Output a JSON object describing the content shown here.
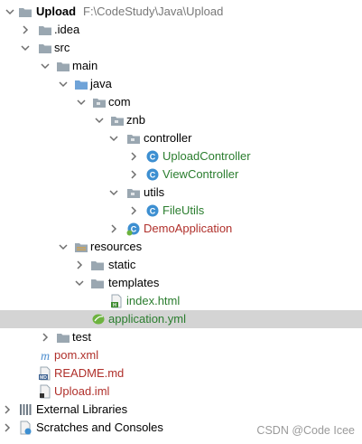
{
  "tree": {
    "project_name": "Upload",
    "project_path": "F:\\CodeStudy\\Java\\Upload",
    "idea": ".idea",
    "src": "src",
    "main": "main",
    "java": "java",
    "com": "com",
    "znb": "znb",
    "controller": "controller",
    "upload_controller": "UploadController",
    "view_controller": "ViewController",
    "utils": "utils",
    "file_utils": "FileUtils",
    "demo_application": "DemoApplication",
    "resources": "resources",
    "static": "static",
    "templates": "templates",
    "index_html": "index.html",
    "application_yml": "application.yml",
    "test": "test",
    "pom_xml": "pom.xml",
    "readme_md": "README.md",
    "upload_iml": "Upload.iml",
    "external_libraries": "External Libraries",
    "scratches": "Scratches and Consoles"
  },
  "watermark": "CSDN @Code Icee",
  "colors": {
    "selected_row": "#d4d4d4",
    "folder": "#9aa7b1",
    "source_folder": "#6fa3d8",
    "resource_folder": "#c9a25a",
    "class_icon": "#3d8fd1",
    "class_text": "#2a7d2e",
    "modified_text": "#b0302b"
  }
}
